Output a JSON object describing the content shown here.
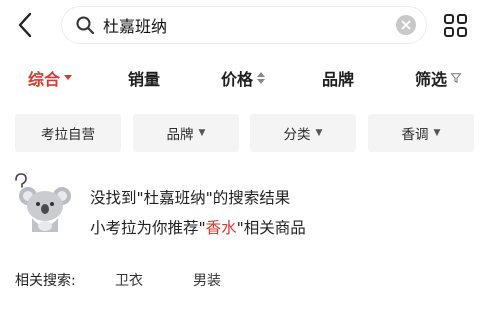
{
  "header": {
    "search_value": "杜嘉班纳",
    "icons": {
      "back": "chevron-left-icon",
      "search": "search-icon",
      "clear": "clear-icon",
      "grid": "grid-view-icon"
    }
  },
  "sort_bar": {
    "items": [
      {
        "label": "综合",
        "active": true,
        "icon": "caret-down-icon"
      },
      {
        "label": "销量"
      },
      {
        "label": "价格",
        "icon": "sort-updown-icon"
      },
      {
        "label": "品牌"
      },
      {
        "label": "筛选",
        "icon": "filter-icon"
      }
    ]
  },
  "filters": [
    {
      "label": "考拉自营"
    },
    {
      "label": "品牌",
      "caret": "▼"
    },
    {
      "label": "分类",
      "caret": "▼"
    },
    {
      "label": "香调",
      "caret": "▼"
    }
  ],
  "empty_result": {
    "line1": "没找到\"杜嘉班纳\"的搜索结果",
    "line2_prefix": "小考拉为你推荐\"",
    "line2_highlight": "香水",
    "line2_suffix": "\"相关商品",
    "mascot": "koala-mascot-icon"
  },
  "related": {
    "label": "相关搜索:",
    "tags": [
      "卫衣",
      "男装"
    ]
  },
  "colors": {
    "accent": "#d8382e",
    "chip_bg": "#f4f4f4"
  }
}
